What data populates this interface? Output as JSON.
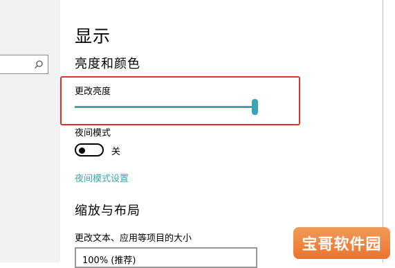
{
  "page_title": "显示",
  "sections": {
    "brightness_color": {
      "title": "亮度和颜色"
    },
    "scale_layout": {
      "title": "缩放与布局"
    }
  },
  "brightness": {
    "label": "更改亮度",
    "value_fraction": 1.0
  },
  "night_mode": {
    "label": "夜间模式",
    "toggle_state": "关",
    "settings_link": "夜间模式设置"
  },
  "scale": {
    "label": "更改文本、应用等项目的大小",
    "dropdown_value": "100% (推荐)"
  },
  "search": {
    "icon": "search-icon"
  },
  "colors": {
    "accent": "#3aa5b0",
    "highlight_border": "#d9312b",
    "watermark_bg": "#ee8340"
  },
  "watermark": {
    "text": "宝哥软件园"
  }
}
